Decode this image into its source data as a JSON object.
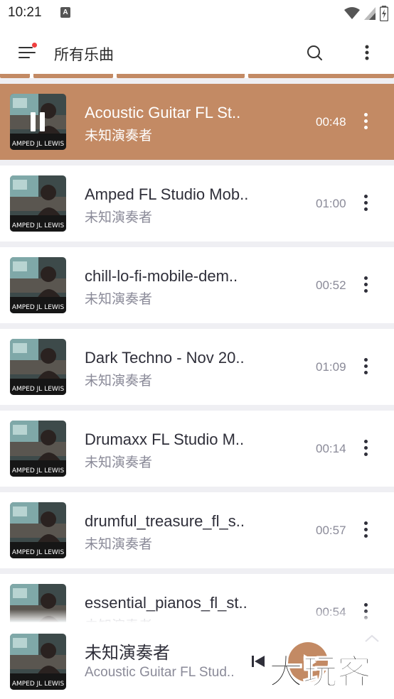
{
  "status_bar": {
    "time": "10:21",
    "notification_badge": "A"
  },
  "app_bar": {
    "title": "所有乐曲"
  },
  "songs": [
    {
      "title": "Acoustic Guitar FL St..",
      "artist": "未知演奏者",
      "duration": "00:48",
      "playing": true
    },
    {
      "title": "Amped FL Studio Mob..",
      "artist": "未知演奏者",
      "duration": "01:00",
      "playing": false
    },
    {
      "title": "chill-lo-fi-mobile-dem..",
      "artist": "未知演奏者",
      "duration": "00:52",
      "playing": false
    },
    {
      "title": "Dark Techno - Nov 20..",
      "artist": "未知演奏者",
      "duration": "01:09",
      "playing": false
    },
    {
      "title": "Drumaxx FL Studio M..",
      "artist": "未知演奏者",
      "duration": "00:14",
      "playing": false
    },
    {
      "title": "drumful_treasure_fl_s..",
      "artist": "未知演奏者",
      "duration": "00:57",
      "playing": false
    },
    {
      "title": "essential_pianos_fl_st..",
      "artist": "未知演奏者",
      "duration": "00:54",
      "playing": false
    }
  ],
  "mini_player": {
    "artist": "未知演奏者",
    "title": "Acoustic Guitar FL Stud.."
  },
  "watermark": "大玩客",
  "colors": {
    "accent": "#c38a64",
    "list_background": "#efeff3",
    "primary_text": "#2f2f3a",
    "secondary_text": "#8a8a98"
  },
  "icons": {
    "menu": "menu-icon",
    "search": "search-icon",
    "more": "more-vertical-icon",
    "pause": "pause-icon",
    "previous": "skip-previous-icon",
    "play": "play-icon",
    "collapse": "chevron-up-icon"
  }
}
